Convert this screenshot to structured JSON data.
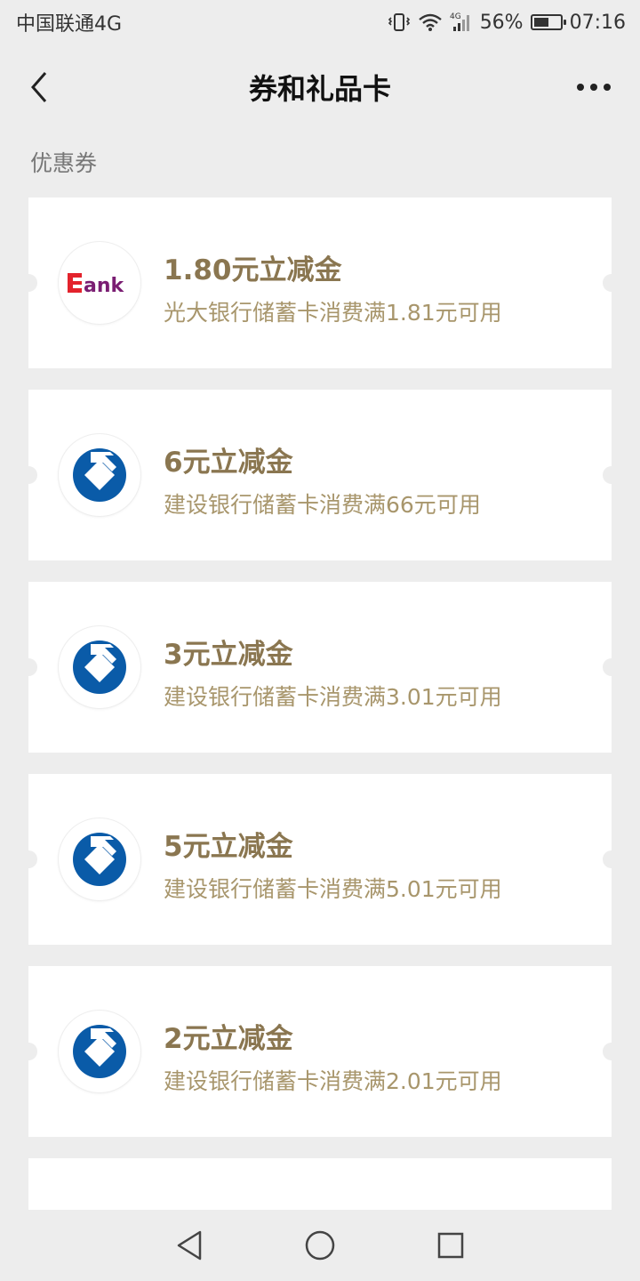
{
  "status_bar": {
    "carrier": "中国联通4G",
    "network": "4G",
    "battery_percent_text": "56%",
    "battery_level": 0.56,
    "time": "07:16"
  },
  "nav": {
    "title": "券和礼品卡"
  },
  "section_label": "优惠券",
  "colors": {
    "coupon_title": "#8a7650",
    "coupon_desc": "#a8966c",
    "ccb_blue": "#0a5ba8",
    "ceb_red": "#e3232c",
    "ceb_purple": "#7a1d72"
  },
  "coupons": [
    {
      "logo": "bank-logo-icon",
      "logo_text": "ank",
      "title": "1.80元立减金",
      "desc": "光大银行储蓄卡消费满1.81元可用"
    },
    {
      "logo": "ccb-logo-icon",
      "title": "6元立减金",
      "desc": "建设银行储蓄卡消费满66元可用"
    },
    {
      "logo": "ccb-logo-icon",
      "title": "3元立减金",
      "desc": "建设银行储蓄卡消费满3.01元可用"
    },
    {
      "logo": "ccb-logo-icon",
      "title": "5元立减金",
      "desc": "建设银行储蓄卡消费满5.01元可用"
    },
    {
      "logo": "ccb-logo-icon",
      "title": "2元立减金",
      "desc": "建设银行储蓄卡消费满2.01元可用"
    }
  ]
}
